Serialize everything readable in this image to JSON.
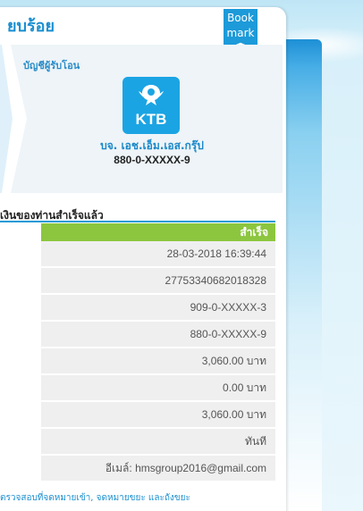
{
  "card": {
    "title": "ยบร้อย",
    "bookmark_label": "Book mark"
  },
  "recipient": {
    "label": "บัญชีผู้รับโอน",
    "bank_logo_text": "KTB",
    "bank_icon": "ktb-logo-icon",
    "name": "บจ. เอช.เอ็ม.เอส.กรุ๊ป",
    "account": "880-0-XXXXX-9"
  },
  "result": {
    "heading": "เงินของท่านสำเร็จแล้ว",
    "status": "สำเร็จ",
    "values": [
      "28-03-2018 16:39:44",
      "27753340682018328",
      "909-0-XXXXX-3",
      "880-0-XXXXX-9",
      "3,060.00 บาท",
      "0.00 บาท",
      "3,060.00 บาท",
      "ทันที",
      "อีเมล์: hmsgroup2016@gmail.com"
    ]
  },
  "footer": {
    "link_text": "ตรวจสอบที่จดหมายเข้า, จดหมายขยะ และถังขยะ"
  },
  "colors": {
    "accent": "#1a8fd0",
    "status_green": "#8cc63f",
    "bookmark_blue": "#1d9ad9",
    "ktb_blue": "#1ba4e3"
  }
}
